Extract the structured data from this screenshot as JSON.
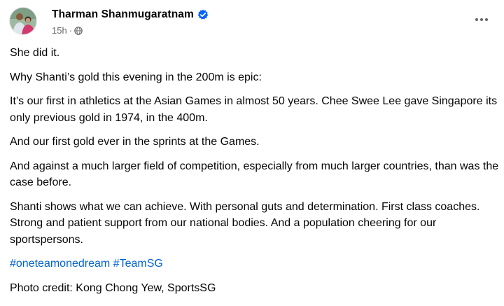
{
  "post": {
    "author": "Tharman Shanmugaratnam",
    "time": "15h",
    "separator": "·",
    "icons": {
      "verified": "verified-badge-icon",
      "audience": "globe-icon",
      "more": "more-options-icon"
    },
    "colors": {
      "link": "#0064d1",
      "verified": "#0866ff",
      "meta": "#65676b"
    },
    "paragraphs": [
      "She did it.",
      "Why Shanti’s gold this evening in the 200m is epic:",
      "It’s our first in athletics at the Asian Games in almost 50 years. Chee Swee Lee gave Singapore its only previous gold in 1974, in the 400m.",
      "And our first gold ever in the sprints at the Games.",
      "And against a much larger field of competition, especially from much larger countries, than was the case before.",
      "Shanti shows what we can achieve. With personal guts and determination. First class coaches. Strong and patient support from our national bodies. And a population cheering for our sportspersons."
    ],
    "hashtags": [
      "#oneteamonedream",
      "#TeamSG"
    ],
    "photo_credit": "Photo credit: Kong Chong Yew, SportsSG"
  }
}
